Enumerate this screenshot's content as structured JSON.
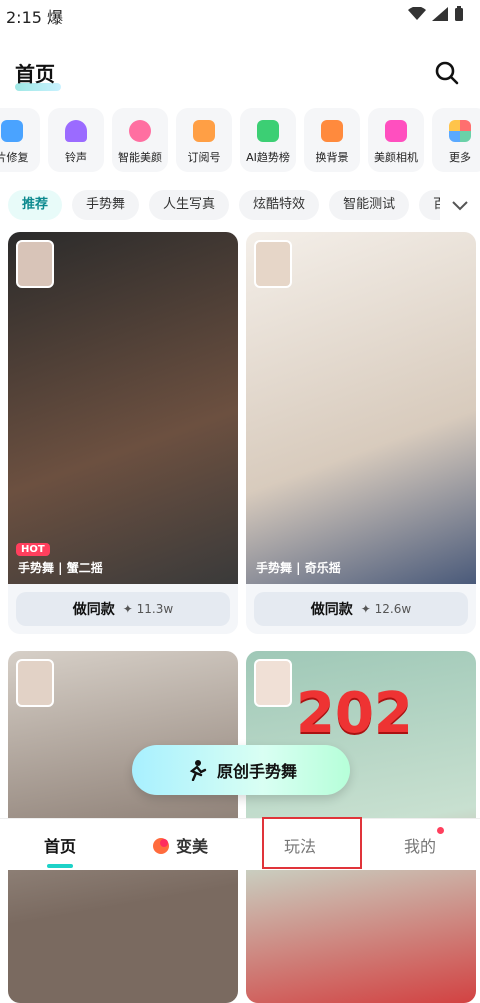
{
  "status_bar": {
    "time": "2:15",
    "weather": "爆"
  },
  "header": {
    "title": "首页"
  },
  "tools": [
    {
      "label": "片修复",
      "icon": "hd-icon",
      "color": "#4aa3ff"
    },
    {
      "label": "铃声",
      "icon": "bell-icon",
      "color": "#9b6bff"
    },
    {
      "label": "智能美颜",
      "icon": "face-icon",
      "color": "#ff6fa1"
    },
    {
      "label": "订阅号",
      "icon": "fox-icon",
      "color": "#ff9f45"
    },
    {
      "label": "AI趋势榜",
      "icon": "chart-icon",
      "color": "#3ccf74"
    },
    {
      "label": "换背景",
      "icon": "background-icon",
      "color": "#ff8a3d"
    },
    {
      "label": "美颜相机",
      "icon": "camera-icon",
      "color": "#ff4fbf"
    },
    {
      "label": "更多",
      "icon": "more-icon",
      "color": "#6ad1a8"
    }
  ],
  "tabs": [
    "推荐",
    "手势舞",
    "人生写真",
    "炫酷特效",
    "智能测试",
    "百"
  ],
  "cards": [
    {
      "tag": "手势舞 | 蟹二摇",
      "hot": "HOT",
      "button": "做同款",
      "count": "11.3w",
      "bg1": "#3a3a3a",
      "bg2": "#7a5a4a"
    },
    {
      "tag": "手势舞 | 奇乐摇",
      "hot": "",
      "button": "做同款",
      "count": "12.6w",
      "bg1": "#efe7df",
      "bg2": "#c9b8a8"
    },
    {
      "tag": "",
      "hot": "",
      "button": "",
      "count": "",
      "bg1": "#cfc7c0",
      "bg2": "#6a5a50"
    },
    {
      "tag": "",
      "hot": "",
      "button": "",
      "count": "",
      "bg1": "#b0d4c6",
      "bg2": "#e84040",
      "overlay": "202"
    }
  ],
  "float_button": {
    "label": "原创手势舞"
  },
  "bottom_nav": [
    {
      "label": "首页",
      "active": true
    },
    {
      "label": "变美",
      "active": false
    },
    {
      "label": "玩法",
      "active": false
    },
    {
      "label": "我的",
      "active": false
    }
  ],
  "colors": {
    "accent": "#1dd2c8",
    "hot": "#ff3f5d",
    "highlight": "#e0343a"
  }
}
